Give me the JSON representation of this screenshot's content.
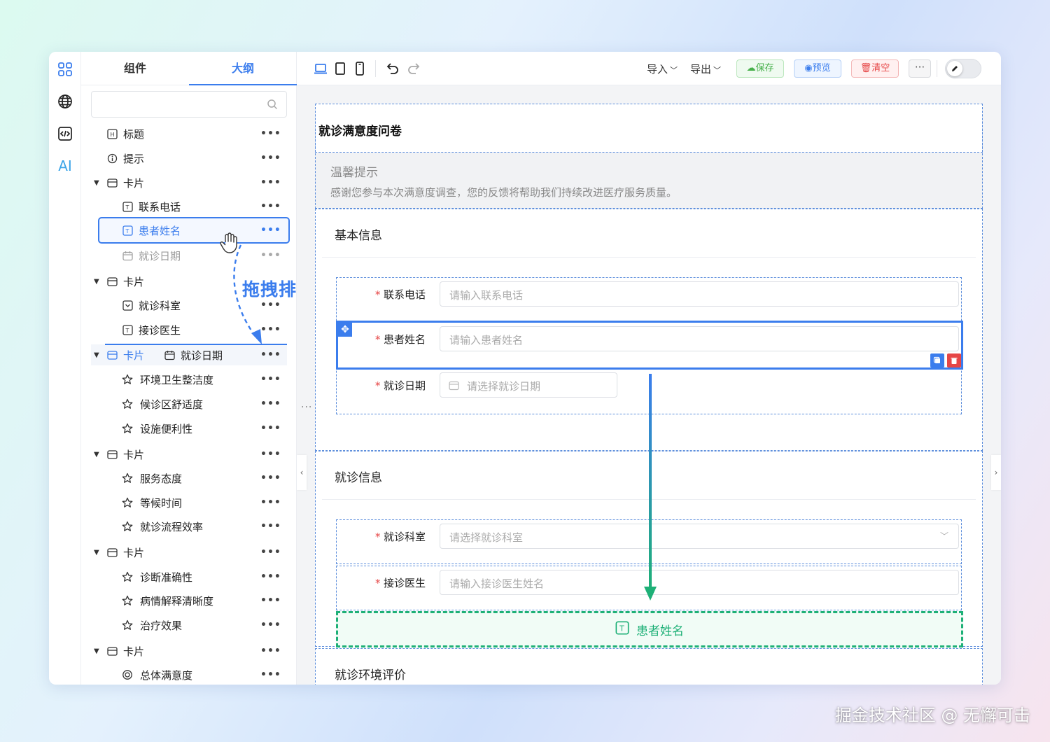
{
  "outline": {
    "tabs": [
      "组件",
      "大纲"
    ],
    "search_placeholder": "",
    "items": [
      {
        "label": "标题",
        "icon": "heading-icon"
      },
      {
        "label": "提示",
        "icon": "info-icon"
      },
      {
        "label": "卡片",
        "icon": "card-icon"
      },
      {
        "label": "联系电话",
        "icon": "text-field-icon"
      },
      {
        "label": "患者姓名",
        "icon": "text-field-icon"
      },
      {
        "label": "就诊日期",
        "icon": "calendar-icon"
      },
      {
        "label": "卡片",
        "icon": "card-icon"
      },
      {
        "label": "就诊科室",
        "icon": "select-icon"
      },
      {
        "label": "接诊医生",
        "icon": "text-field-icon"
      },
      {
        "label": "卡片",
        "icon": "card-icon"
      },
      {
        "label": "就诊日期",
        "icon": "calendar-icon"
      },
      {
        "label": "环境卫生整洁度",
        "icon": "star-icon"
      },
      {
        "label": "候诊区舒适度",
        "icon": "star-icon"
      },
      {
        "label": "设施便利性",
        "icon": "star-icon"
      },
      {
        "label": "卡片",
        "icon": "card-icon"
      },
      {
        "label": "服务态度",
        "icon": "star-icon"
      },
      {
        "label": "等候时间",
        "icon": "star-icon"
      },
      {
        "label": "就诊流程效率",
        "icon": "star-icon"
      },
      {
        "label": "卡片",
        "icon": "card-icon"
      },
      {
        "label": "诊断准确性",
        "icon": "star-icon"
      },
      {
        "label": "病情解释清晰度",
        "icon": "star-icon"
      },
      {
        "label": "治疗效果",
        "icon": "star-icon"
      },
      {
        "label": "卡片",
        "icon": "card-icon"
      },
      {
        "label": "总体满意度",
        "icon": "radio-icon"
      }
    ],
    "more": "•••",
    "drag_hint": "拖拽排序"
  },
  "toolbar": {
    "import_label": "导入",
    "export_label": "导出",
    "save_label": "保存",
    "preview_label": "预览",
    "clear_label": "清空",
    "more_label": "···"
  },
  "form": {
    "title": "就诊满意度问卷",
    "tip_title": "温馨提示",
    "tip_body": "感谢您参与本次满意度调查，您的反馈将帮助我们持续改进医疗服务质量。",
    "card1": {
      "title": "基本信息",
      "fields": [
        {
          "label": "联系电话",
          "placeholder": "请输入联系电话"
        },
        {
          "label": "患者姓名",
          "placeholder": "请输入患者姓名"
        },
        {
          "label": "就诊日期",
          "placeholder": "请选择就诊日期"
        }
      ]
    },
    "card2": {
      "title": "就诊信息",
      "fields": [
        {
          "label": "就诊科室",
          "placeholder": "请选择就诊科室"
        },
        {
          "label": "接诊医生",
          "placeholder": "请输入接诊医生姓名"
        }
      ]
    },
    "ghost_label": "患者姓名",
    "card3": {
      "title": "就诊环境评价"
    },
    "required_mark": "*"
  },
  "colors": {
    "accent": "#3b7ded",
    "drop": "#1eb077",
    "danger": "#e64646",
    "save": "#47b04b"
  },
  "watermark": "掘金技术社区 @ 无懈可击"
}
